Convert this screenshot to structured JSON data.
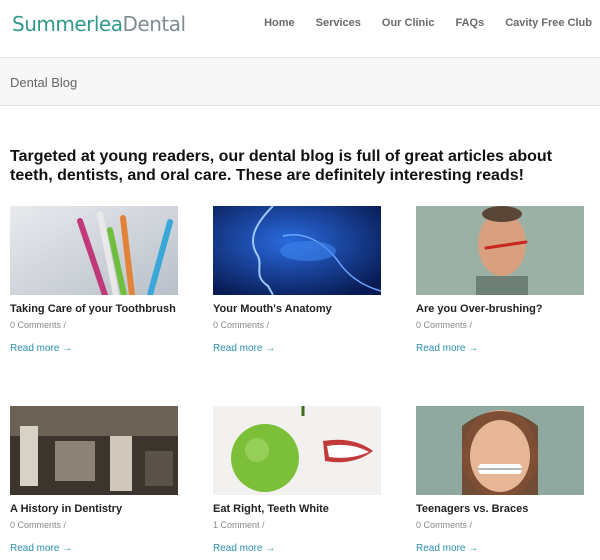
{
  "site": {
    "logo_part1": "Summerlea",
    "logo_part2": "Dental"
  },
  "nav": [
    "Home",
    "Services",
    "Our Clinic",
    "FAQs",
    "Cavity Free Club"
  ],
  "page": {
    "title": "Dental Blog",
    "intro": "Targeted at young readers, our dental blog is full of great articles about teeth, dentists, and oral care. These are definitely interesting reads!"
  },
  "posts": [
    {
      "title": "Taking Care of your Toothbrush",
      "meta": "0 Comments /",
      "more": "Read more →"
    },
    {
      "title": "Your Mouth's Anatomy",
      "meta": "0 Comments /",
      "more": "Read more →"
    },
    {
      "title": "Are you Over-brushing?",
      "meta": "0 Comments /",
      "more": "Read more →"
    },
    {
      "title": "A History in Dentistry",
      "meta": "0 Comments /",
      "more": "Read more →"
    },
    {
      "title": "Eat Right, Teeth White",
      "meta": "1 Comment /",
      "more": "Read more →"
    },
    {
      "title": "Teenagers vs. Braces",
      "meta": "0 Comments /",
      "more": "Read more →"
    }
  ],
  "colors": {
    "logo_accent": "#2f9a8c",
    "logo_secondary": "#7f8d92",
    "link": "#2a8fb1"
  }
}
